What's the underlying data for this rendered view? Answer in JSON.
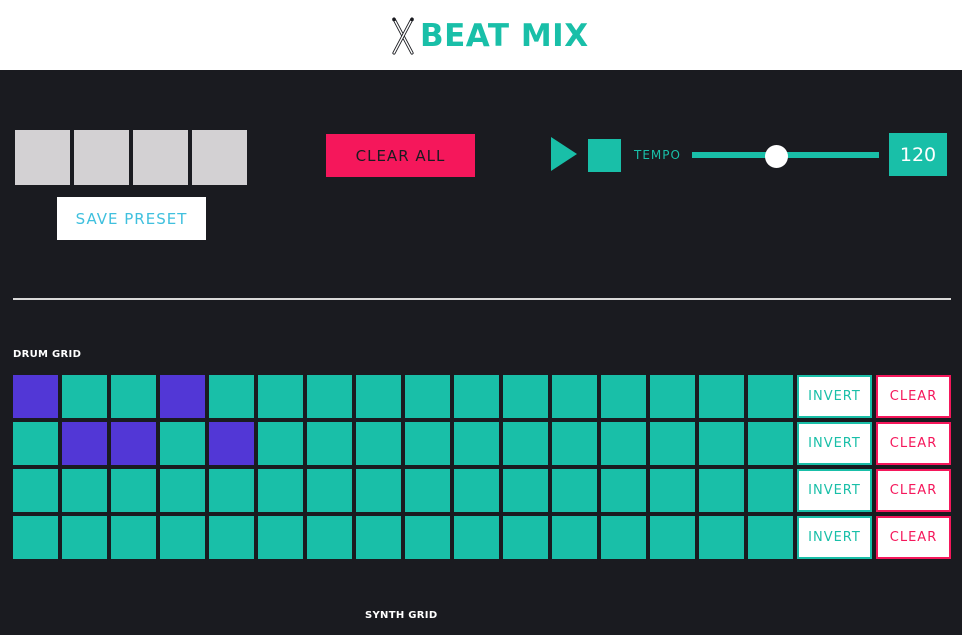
{
  "header": {
    "title": "BEAT MIX",
    "icon": "drumsticks-icon",
    "brand_color": "#19bfa8"
  },
  "presets": {
    "slot_count": 4,
    "save_label": "SAVE PRESET"
  },
  "controls": {
    "clear_all_label": "CLEAR ALL",
    "play_icon": "play-icon",
    "stop_icon": "stop-icon",
    "tempo_label": "TEMPO",
    "tempo_value": "120",
    "tempo_level": 0.45
  },
  "drum_grid": {
    "label": "DRUM GRID",
    "invert_label": "INVERT",
    "clear_label": "CLEAR",
    "rows": [
      [
        1,
        0,
        0,
        1,
        0,
        0,
        0,
        0,
        0,
        0,
        0,
        0,
        0,
        0,
        0,
        0
      ],
      [
        0,
        1,
        1,
        0,
        1,
        0,
        0,
        0,
        0,
        0,
        0,
        0,
        0,
        0,
        0,
        0
      ],
      [
        0,
        0,
        0,
        0,
        0,
        0,
        0,
        0,
        0,
        0,
        0,
        0,
        0,
        0,
        0,
        0
      ],
      [
        0,
        0,
        0,
        0,
        0,
        0,
        0,
        0,
        0,
        0,
        0,
        0,
        0,
        0,
        0,
        0
      ]
    ],
    "on_color": "#5237d6",
    "off_color": "#19bfa8"
  },
  "synth_grid": {
    "label": "SYNTH GRID"
  },
  "colors": {
    "background": "#1a1b20",
    "accent_teal": "#19bfa8",
    "accent_pink": "#f5175b",
    "accent_blue": "#3fc0de"
  }
}
